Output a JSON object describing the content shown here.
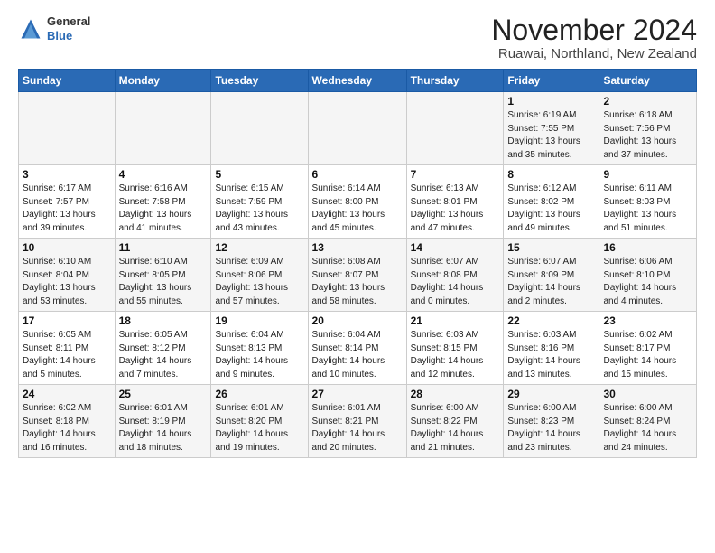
{
  "header": {
    "logo_general": "General",
    "logo_blue": "Blue",
    "month_title": "November 2024",
    "location": "Ruawai, Northland, New Zealand"
  },
  "days_of_week": [
    "Sunday",
    "Monday",
    "Tuesday",
    "Wednesday",
    "Thursday",
    "Friday",
    "Saturday"
  ],
  "weeks": [
    [
      {
        "day": "",
        "info": ""
      },
      {
        "day": "",
        "info": ""
      },
      {
        "day": "",
        "info": ""
      },
      {
        "day": "",
        "info": ""
      },
      {
        "day": "",
        "info": ""
      },
      {
        "day": "1",
        "info": "Sunrise: 6:19 AM\nSunset: 7:55 PM\nDaylight: 13 hours\nand 35 minutes."
      },
      {
        "day": "2",
        "info": "Sunrise: 6:18 AM\nSunset: 7:56 PM\nDaylight: 13 hours\nand 37 minutes."
      }
    ],
    [
      {
        "day": "3",
        "info": "Sunrise: 6:17 AM\nSunset: 7:57 PM\nDaylight: 13 hours\nand 39 minutes."
      },
      {
        "day": "4",
        "info": "Sunrise: 6:16 AM\nSunset: 7:58 PM\nDaylight: 13 hours\nand 41 minutes."
      },
      {
        "day": "5",
        "info": "Sunrise: 6:15 AM\nSunset: 7:59 PM\nDaylight: 13 hours\nand 43 minutes."
      },
      {
        "day": "6",
        "info": "Sunrise: 6:14 AM\nSunset: 8:00 PM\nDaylight: 13 hours\nand 45 minutes."
      },
      {
        "day": "7",
        "info": "Sunrise: 6:13 AM\nSunset: 8:01 PM\nDaylight: 13 hours\nand 47 minutes."
      },
      {
        "day": "8",
        "info": "Sunrise: 6:12 AM\nSunset: 8:02 PM\nDaylight: 13 hours\nand 49 minutes."
      },
      {
        "day": "9",
        "info": "Sunrise: 6:11 AM\nSunset: 8:03 PM\nDaylight: 13 hours\nand 51 minutes."
      }
    ],
    [
      {
        "day": "10",
        "info": "Sunrise: 6:10 AM\nSunset: 8:04 PM\nDaylight: 13 hours\nand 53 minutes."
      },
      {
        "day": "11",
        "info": "Sunrise: 6:10 AM\nSunset: 8:05 PM\nDaylight: 13 hours\nand 55 minutes."
      },
      {
        "day": "12",
        "info": "Sunrise: 6:09 AM\nSunset: 8:06 PM\nDaylight: 13 hours\nand 57 minutes."
      },
      {
        "day": "13",
        "info": "Sunrise: 6:08 AM\nSunset: 8:07 PM\nDaylight: 13 hours\nand 58 minutes."
      },
      {
        "day": "14",
        "info": "Sunrise: 6:07 AM\nSunset: 8:08 PM\nDaylight: 14 hours\nand 0 minutes."
      },
      {
        "day": "15",
        "info": "Sunrise: 6:07 AM\nSunset: 8:09 PM\nDaylight: 14 hours\nand 2 minutes."
      },
      {
        "day": "16",
        "info": "Sunrise: 6:06 AM\nSunset: 8:10 PM\nDaylight: 14 hours\nand 4 minutes."
      }
    ],
    [
      {
        "day": "17",
        "info": "Sunrise: 6:05 AM\nSunset: 8:11 PM\nDaylight: 14 hours\nand 5 minutes."
      },
      {
        "day": "18",
        "info": "Sunrise: 6:05 AM\nSunset: 8:12 PM\nDaylight: 14 hours\nand 7 minutes."
      },
      {
        "day": "19",
        "info": "Sunrise: 6:04 AM\nSunset: 8:13 PM\nDaylight: 14 hours\nand 9 minutes."
      },
      {
        "day": "20",
        "info": "Sunrise: 6:04 AM\nSunset: 8:14 PM\nDaylight: 14 hours\nand 10 minutes."
      },
      {
        "day": "21",
        "info": "Sunrise: 6:03 AM\nSunset: 8:15 PM\nDaylight: 14 hours\nand 12 minutes."
      },
      {
        "day": "22",
        "info": "Sunrise: 6:03 AM\nSunset: 8:16 PM\nDaylight: 14 hours\nand 13 minutes."
      },
      {
        "day": "23",
        "info": "Sunrise: 6:02 AM\nSunset: 8:17 PM\nDaylight: 14 hours\nand 15 minutes."
      }
    ],
    [
      {
        "day": "24",
        "info": "Sunrise: 6:02 AM\nSunset: 8:18 PM\nDaylight: 14 hours\nand 16 minutes."
      },
      {
        "day": "25",
        "info": "Sunrise: 6:01 AM\nSunset: 8:19 PM\nDaylight: 14 hours\nand 18 minutes."
      },
      {
        "day": "26",
        "info": "Sunrise: 6:01 AM\nSunset: 8:20 PM\nDaylight: 14 hours\nand 19 minutes."
      },
      {
        "day": "27",
        "info": "Sunrise: 6:01 AM\nSunset: 8:21 PM\nDaylight: 14 hours\nand 20 minutes."
      },
      {
        "day": "28",
        "info": "Sunrise: 6:00 AM\nSunset: 8:22 PM\nDaylight: 14 hours\nand 21 minutes."
      },
      {
        "day": "29",
        "info": "Sunrise: 6:00 AM\nSunset: 8:23 PM\nDaylight: 14 hours\nand 23 minutes."
      },
      {
        "day": "30",
        "info": "Sunrise: 6:00 AM\nSunset: 8:24 PM\nDaylight: 14 hours\nand 24 minutes."
      }
    ]
  ]
}
